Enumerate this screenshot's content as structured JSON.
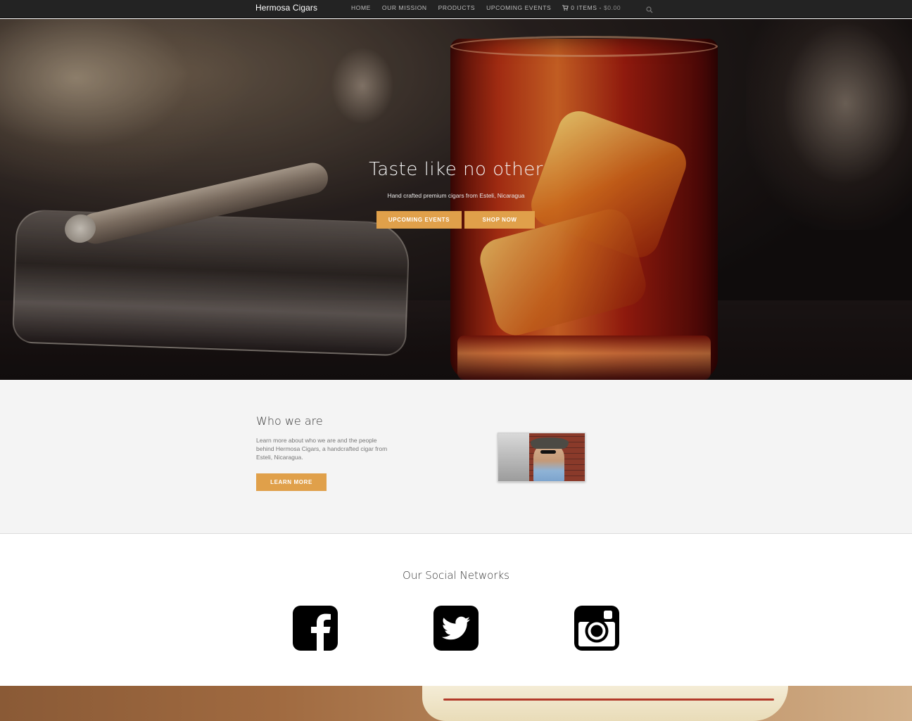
{
  "nav": {
    "brand": "Hermosa Cigars",
    "items": [
      "HOME",
      "OUR MISSION",
      "PRODUCTS",
      "UPCOMING EVENTS"
    ],
    "cart_count": "0 ITEMS -",
    "cart_amount": "$0.00",
    "cart_icon": "shopping-cart-icon",
    "search_icon": "search-icon"
  },
  "hero": {
    "title": "Taste like no other",
    "subtitle": "Hand crafted premium cigars from Esteli, Nicaragua",
    "buttons": [
      "UPCOMING EVENTS",
      "SHOP NOW"
    ]
  },
  "who": {
    "title": "Who we are",
    "text": "Learn more about who we are and the people behind Hermosa Cigars, a handcrafted cigar from Esteli, Nicaragua.",
    "button": "LEARN MORE"
  },
  "social": {
    "title": "Our Social Networks",
    "icons": [
      "facebook-icon",
      "twitter-icon",
      "instagram-icon"
    ]
  },
  "colors": {
    "accent": "#e0a04a",
    "nav_bg": "#232323",
    "who_bg": "#f4f4f4"
  }
}
